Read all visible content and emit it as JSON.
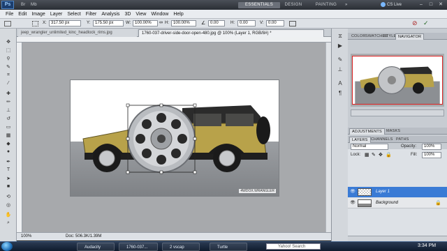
{
  "appbar": {
    "logo": "Ps",
    "workspaces": [
      "ESSENTIALS",
      "DESIGN",
      "PAINTING",
      "»"
    ],
    "cs_live": "CS Live",
    "window_buttons": [
      "–",
      "□",
      "✕"
    ]
  },
  "menu": [
    "File",
    "Edit",
    "Image",
    "Layer",
    "Select",
    "Filter",
    "Analysis",
    "3D",
    "View",
    "Window",
    "Help"
  ],
  "options": {
    "x_label": "X:",
    "x_value": "317.50 px",
    "y_label": "Y:",
    "y_value": "175.50 px",
    "w_label": "W:",
    "w_value": "100.00%",
    "h_label": "H:",
    "h_value": "100.00%",
    "angle_value": "0.00",
    "h_skew_label": "H:",
    "h_skew_value": "0.00",
    "v_skew_label": "V:",
    "v_skew_value": "0.00"
  },
  "documents": {
    "tabs": [
      "jeep_wrangler_unlimited_kinc_headlock_rims.jpg",
      "1760-037-driver-side-door-open-480.jpg @ 100% (Layer 1, RGB/8#) *"
    ],
    "active_tab": 1
  },
  "status": {
    "zoom": "100%",
    "doc": "Doc: 506.3K/1.39M"
  },
  "image": {
    "watermark": "4WDOX.WRANGLER"
  },
  "colors": {
    "foreground": "#d0491b",
    "background": "#ffffff",
    "layer_selected": "#3a7bd5",
    "jeep_body": "#b8a24a"
  },
  "panels": {
    "top_tabs": [
      "COLOR",
      "SWATCHES",
      "STYLES",
      "NAVIGATOR"
    ],
    "top_active": "NAVIGATOR",
    "mid_tabs": [
      "ADJUSTMENTS",
      "MASKS"
    ],
    "layer_tabs": [
      "LAYERS",
      "CHANNELS",
      "PATHS"
    ],
    "blend_mode": "Normal",
    "opacity_label": "Opacity:",
    "opacity_value": "100%",
    "lock_label": "Lock:",
    "fill_label": "Fill:",
    "fill_value": "100%",
    "layers": [
      "Layer 1",
      "Background"
    ]
  },
  "taskbar": {
    "tasks": [
      "Audacity",
      "1760-037...",
      "2 vscap",
      "Turtle"
    ],
    "search_placeholder": "Yahoo! Search",
    "clock": "3:34 PM"
  }
}
